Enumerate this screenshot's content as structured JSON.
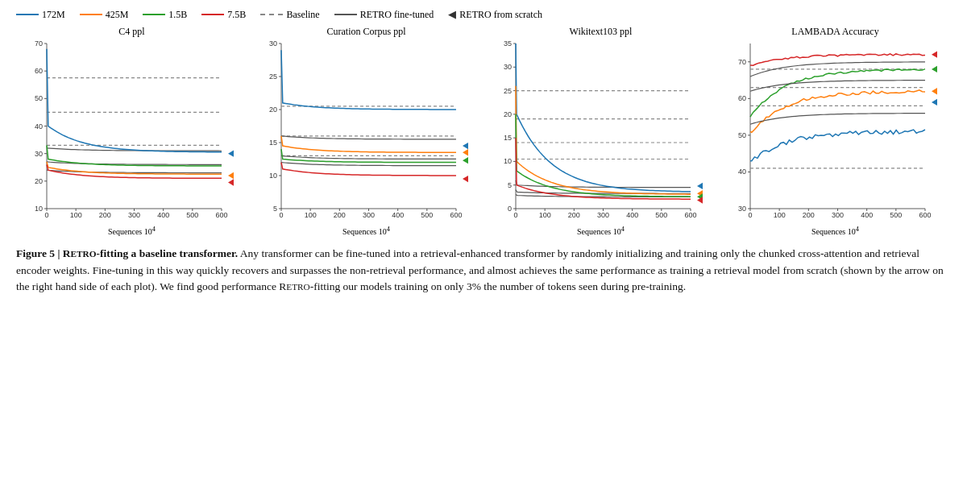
{
  "legend": {
    "items": [
      {
        "label": "172M",
        "color": "#1f77b4",
        "type": "solid"
      },
      {
        "label": "425M",
        "color": "#ff7f0e",
        "type": "solid"
      },
      {
        "label": "1.5B",
        "color": "#2ca02c",
        "type": "solid"
      },
      {
        "label": "7.5B",
        "color": "#d62728",
        "type": "solid"
      },
      {
        "label": "Baseline",
        "color": "#888888",
        "type": "dashed"
      },
      {
        "label": "RETRO fine-tuned",
        "color": "#555555",
        "type": "solid"
      },
      {
        "label": "RETRO from scratch",
        "color": "#333333",
        "type": "arrow"
      }
    ]
  },
  "charts": [
    {
      "title": "C4 ppl",
      "ymin": 10,
      "ymax": 70,
      "yticks": [
        10,
        20,
        30,
        40,
        50,
        60,
        70
      ],
      "xmax": 600,
      "xticks": [
        0,
        100,
        200,
        300,
        400,
        500,
        600
      ]
    },
    {
      "title": "Curation Corpus ppl",
      "ymin": 5,
      "ymax": 30,
      "yticks": [
        5,
        10,
        15,
        20,
        25,
        30
      ],
      "xmax": 600,
      "xticks": [
        0,
        100,
        200,
        300,
        400,
        500,
        600
      ]
    },
    {
      "title": "Wikitext103 ppl",
      "ymin": 0,
      "ymax": 35,
      "yticks": [
        0,
        5,
        10,
        15,
        20,
        25,
        30,
        35
      ],
      "xmax": 600,
      "xticks": [
        0,
        100,
        200,
        300,
        400,
        500,
        600
      ]
    },
    {
      "title": "LAMBADA Accuracy",
      "ymin": 30,
      "ymax": 75,
      "yticks": [
        30,
        40,
        50,
        60,
        70
      ],
      "xmax": 600,
      "xticks": [
        0,
        100,
        200,
        300,
        400,
        500,
        600
      ]
    }
  ],
  "caption": {
    "figure_label": "Figure 5",
    "bold_part": "RETRO-fitting a baseline transformer.",
    "text": " Any transformer can be fine-tuned into a retrieval-enhanced transformer by randomly initializing and training only the chunked cross-attention and retrieval encoder weights. Fine-tuning in this way quickly recovers and surpasses the non-retrieval performance, and almost achieves the same performance as training a retrieval model from scratch (shown by the arrow on the right hand side of each plot). We find good performance RETRO-fitting our models training on only 3% the number of tokens seen during pre-training."
  }
}
